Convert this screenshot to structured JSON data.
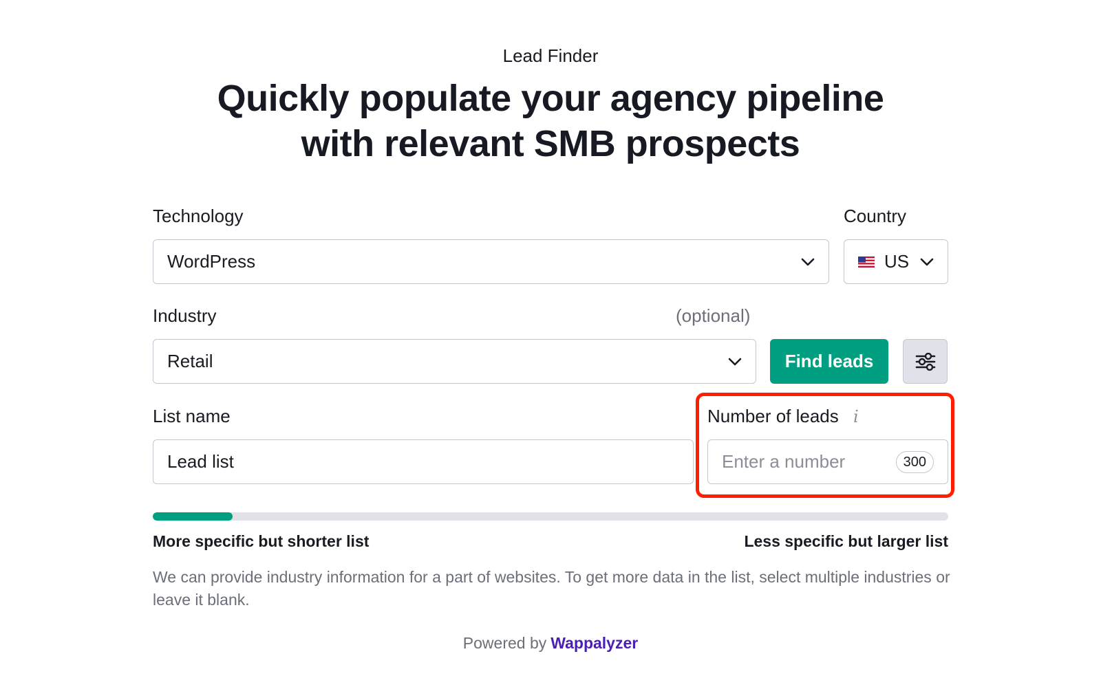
{
  "header": {
    "eyebrow": "Lead Finder",
    "headline_line1": "Quickly populate your agency pipeline",
    "headline_line2": "with relevant SMB prospects"
  },
  "form": {
    "technology": {
      "label": "Technology",
      "value": "WordPress"
    },
    "country": {
      "label": "Country",
      "value": "US",
      "flag": "us-flag-icon"
    },
    "industry": {
      "label": "Industry",
      "optional_note": "(optional)",
      "value": "Retail"
    },
    "find_button_label": "Find leads",
    "filter_icon": "sliders-icon",
    "list_name": {
      "label": "List name",
      "value": "Lead list"
    },
    "number_of_leads": {
      "label": "Number of leads",
      "info_icon": "i",
      "placeholder": "Enter a number",
      "counter": "300"
    }
  },
  "specificity": {
    "level": 0.1,
    "left_label": "More specific but shorter list",
    "right_label": "Less specific but larger list"
  },
  "note": "We can provide industry information for a part of websites. To get more data in the list, select multiple industries or leave it blank.",
  "footer": {
    "prefix": "Powered by",
    "brand": "Wappalyzer"
  },
  "colors": {
    "accent": "#009f81",
    "brand": "#4b1fb5",
    "highlight": "#ff1f00",
    "text": "#191b23",
    "muted": "#6c6e79",
    "border": "#c4c7cf"
  }
}
